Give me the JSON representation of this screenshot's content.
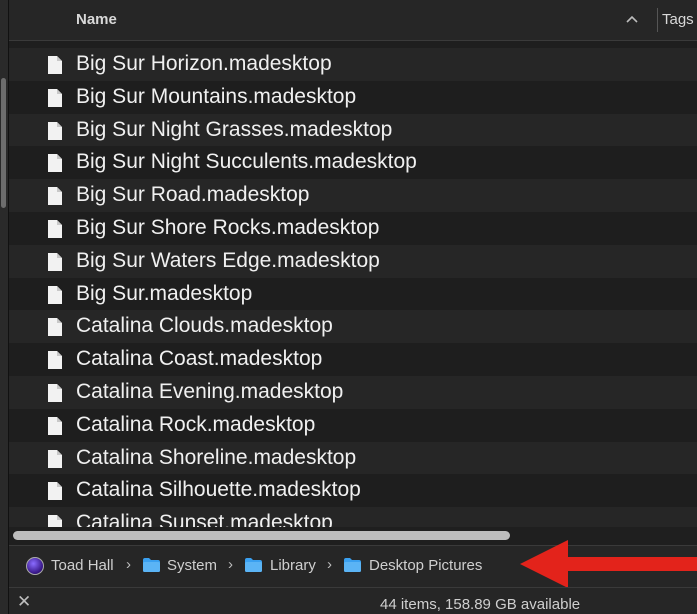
{
  "header": {
    "name_label": "Name",
    "tags_label": "Tags"
  },
  "files": [
    {
      "name": "Big Sur Horizon.madesktop"
    },
    {
      "name": "Big Sur Mountains.madesktop"
    },
    {
      "name": "Big Sur Night Grasses.madesktop"
    },
    {
      "name": "Big Sur Night Succulents.madesktop"
    },
    {
      "name": "Big Sur Road.madesktop"
    },
    {
      "name": "Big Sur Shore Rocks.madesktop"
    },
    {
      "name": "Big Sur Waters Edge.madesktop"
    },
    {
      "name": "Big Sur.madesktop"
    },
    {
      "name": "Catalina Clouds.madesktop"
    },
    {
      "name": "Catalina Coast.madesktop"
    },
    {
      "name": "Catalina Evening.madesktop"
    },
    {
      "name": "Catalina Rock.madesktop"
    },
    {
      "name": "Catalina Shoreline.madesktop"
    },
    {
      "name": "Catalina Silhouette.madesktop"
    },
    {
      "name": "Catalina Sunset.madesktop"
    }
  ],
  "path": [
    {
      "label": "Toad Hall",
      "icon": "disk-icon"
    },
    {
      "label": "System",
      "icon": "folder-icon"
    },
    {
      "label": "Library",
      "icon": "folder-icon"
    },
    {
      "label": "Desktop Pictures",
      "icon": "folder-icon"
    }
  ],
  "path_separator": "›",
  "status": {
    "text": "44 items, 158.89 GB available",
    "close_symbol": "✕"
  },
  "colors": {
    "row_even": "#262626",
    "row_odd": "#1e1e1e",
    "arrow": "#e3231b",
    "folder": "#3aa0f0"
  }
}
